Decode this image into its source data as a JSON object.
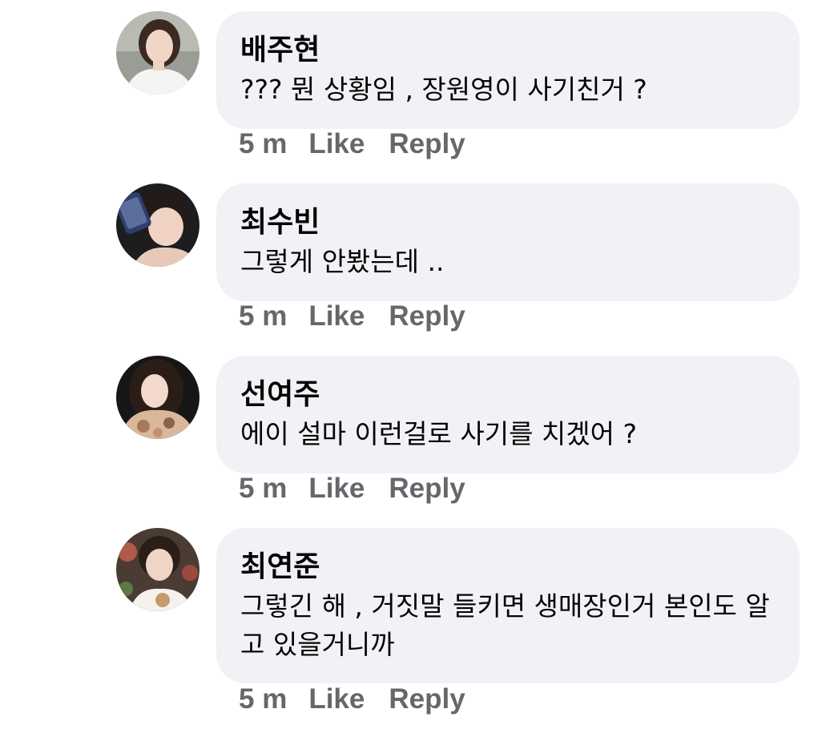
{
  "comments": [
    {
      "author": "배주현",
      "text": "??? 뭔 상황임 , 장원영이 사기친거 ?",
      "time": "5 m",
      "like_label": "Like",
      "reply_label": "Reply"
    },
    {
      "author": "최수빈",
      "text": "그렇게 안봤는데 ..",
      "time": "5 m",
      "like_label": "Like",
      "reply_label": "Reply"
    },
    {
      "author": "선여주",
      "text": "에이 설마 이런걸로 사기를 치겠어 ?",
      "time": "5 m",
      "like_label": "Like",
      "reply_label": "Reply"
    },
    {
      "author": "최연준",
      "text": "그렇긴 해 , 거짓말 들키면 생매장인거 본인도 알고 있을거니까",
      "time": "5 m",
      "like_label": "Like",
      "reply_label": "Reply"
    }
  ],
  "colors": {
    "bubble": "#f0f2f5",
    "text": "#050505",
    "meta": "#65676b"
  }
}
